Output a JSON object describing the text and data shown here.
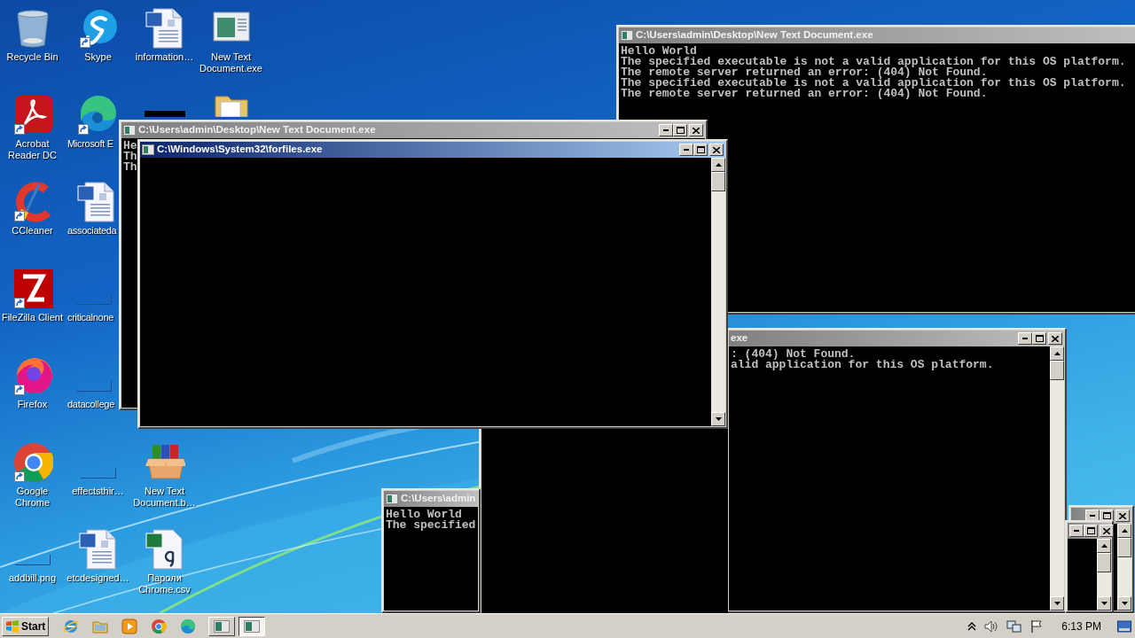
{
  "desktop_icons": [
    {
      "label": "Recycle Bin",
      "shortcut": false
    },
    {
      "label": "Skype",
      "shortcut": true
    },
    {
      "label": "information…",
      "shortcut": false
    },
    {
      "label": "New Text Document.exe",
      "shortcut": false
    },
    {
      "label": "Acrobat Reader DC",
      "shortcut": true
    },
    {
      "label": "Microsoft E",
      "shortcut": true
    },
    {
      "label": "CCleaner",
      "shortcut": true
    },
    {
      "label": "associateda",
      "shortcut": false
    },
    {
      "label": "FileZilla Client",
      "shortcut": true
    },
    {
      "label": "criticalnone",
      "shortcut": false
    },
    {
      "label": "Firefox",
      "shortcut": true
    },
    {
      "label": "datacollege",
      "shortcut": false
    },
    {
      "label": "Google Chrome",
      "shortcut": true
    },
    {
      "label": "effectsthir…",
      "shortcut": false
    },
    {
      "label": "New Text Document.b…",
      "shortcut": false
    },
    {
      "label": "addbill.png",
      "shortcut": false
    },
    {
      "label": "etcdesigned…",
      "shortcut": false
    },
    {
      "label": "Пароли Chrome.csv",
      "shortcut": false
    }
  ],
  "windows": [
    {
      "title": "C:\\Users\\admin\\Desktop\\New Text Document.exe",
      "active": false,
      "lines": [
        "Hello World",
        "The specified executable is not a valid application for this OS platform.",
        "The remote server returned an error: (404) Not Found.",
        "The specified executable is not a valid application for this OS platform.",
        "The remote server returned an error: (404) Not Found."
      ]
    },
    {
      "title": "C:\\Users\\admin",
      "active": false,
      "lines": [
        "Hello World",
        "The specified"
      ]
    },
    {
      "title": "exe",
      "active": false,
      "lines": [
        ": (404) Not Found.",
        "alid application for this OS platform."
      ]
    },
    {
      "title": "C:\\Users\\admin\\Desktop\\New Text Document.exe",
      "active": false,
      "lines": [
        "He",
        "Th",
        "Th"
      ]
    },
    {
      "title": "C:\\Windows\\System32\\forfiles.exe",
      "active": true
    },
    {
      "active": false
    },
    {
      "active": false
    }
  ],
  "taskbar": {
    "start_label": "Start",
    "tasks": [
      {
        "selected": false
      },
      {
        "selected": true
      }
    ],
    "clock": "6:13 PM"
  }
}
